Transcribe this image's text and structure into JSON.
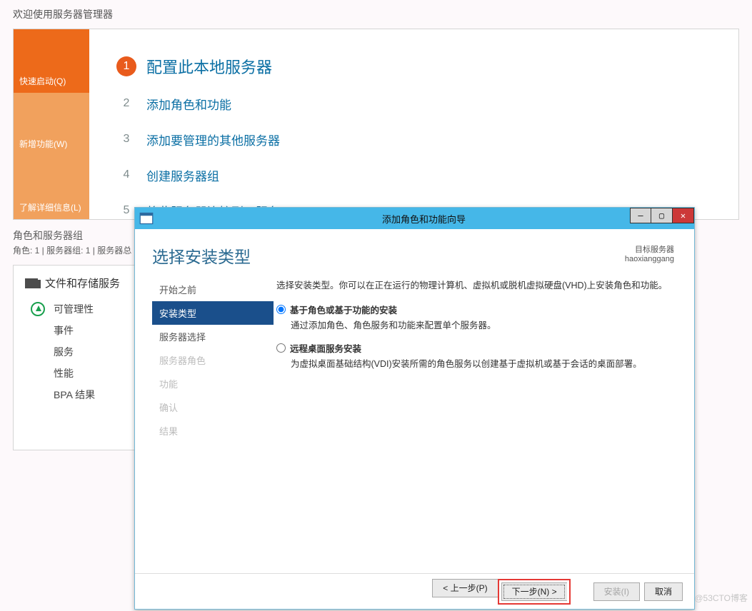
{
  "page_title": "欢迎使用服务器管理器",
  "tiles": [
    {
      "label": "快速启动(Q)",
      "state": "active"
    },
    {
      "label": "新增功能(W)",
      "state": "dim"
    },
    {
      "label": "了解详细信息(L)",
      "state": "dim"
    }
  ],
  "steps": [
    {
      "num": "1",
      "label": "配置此本地服务器"
    },
    {
      "num": "2",
      "label": "添加角色和功能"
    },
    {
      "num": "3",
      "label": "添加要管理的其他服务器"
    },
    {
      "num": "4",
      "label": "创建服务器组"
    },
    {
      "num": "5",
      "label": "将此服务器连接到云服务"
    }
  ],
  "section": {
    "title": "角色和服务器组",
    "subtitle": "角色: 1 | 服务器组: 1 | 服务器总"
  },
  "card": {
    "title": "文件和存储服务",
    "items": [
      "可管理性",
      "事件",
      "服务",
      "性能",
      "BPA 结果"
    ]
  },
  "dialog": {
    "title": "添加角色和功能向导",
    "heading": "选择安装类型",
    "target_label": "目标服务器",
    "target_value": "haoxianggang",
    "nav": [
      {
        "label": "开始之前",
        "state": "normal"
      },
      {
        "label": "安装类型",
        "state": "sel"
      },
      {
        "label": "服务器选择",
        "state": "normal"
      },
      {
        "label": "服务器角色",
        "state": "dis"
      },
      {
        "label": "功能",
        "state": "dis"
      },
      {
        "label": "确认",
        "state": "dis"
      },
      {
        "label": "结果",
        "state": "dis"
      }
    ],
    "lead": "选择安装类型。你可以在正在运行的物理计算机、虚拟机或脱机虚拟硬盘(VHD)上安装角色和功能。",
    "options": [
      {
        "title": "基于角色或基于功能的安装",
        "desc": "通过添加角色、角色服务和功能来配置单个服务器。",
        "checked": true
      },
      {
        "title": "远程桌面服务安装",
        "desc": "为虚拟桌面基础结构(VDI)安装所需的角色服务以创建基于虚拟机或基于会话的桌面部署。",
        "checked": false
      }
    ],
    "buttons": {
      "prev": "< 上一步(P)",
      "next": "下一步(N) >",
      "install": "安装(I)",
      "cancel": "取消"
    }
  },
  "watermark": "@53CTO博客"
}
